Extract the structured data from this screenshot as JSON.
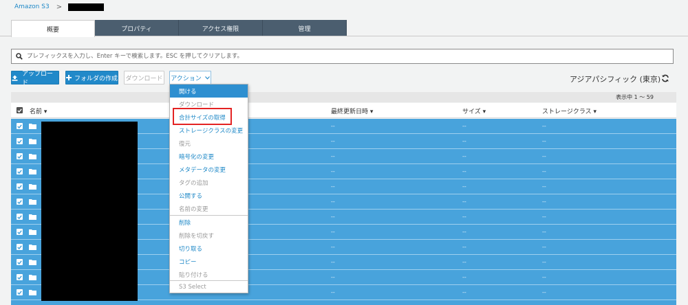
{
  "breadcrumb": {
    "root": "Amazon S3",
    "separator": ">"
  },
  "tabs": [
    {
      "label": "概要",
      "active": true
    },
    {
      "label": "プロパティ",
      "active": false
    },
    {
      "label": "アクセス権限",
      "active": false
    },
    {
      "label": "管理",
      "active": false
    }
  ],
  "search": {
    "placeholder": "プレフィックスを入力し、Enter キーで検索します。ESC を押してクリアします。"
  },
  "toolbar": {
    "upload": "アップロード",
    "create_folder": "フォルダの作成",
    "download": "ダウンロード",
    "actions": "アクション"
  },
  "region": "アジアパシフィック (東京)",
  "count_text": "表示中 1 〜 59",
  "columns": {
    "name": "名前",
    "last_modified": "最終更新日時",
    "size": "サイズ",
    "storage_class": "ストレージクラス"
  },
  "rows": [
    {
      "last_modified": "--",
      "size": "--",
      "storage_class": "--"
    },
    {
      "last_modified": "--",
      "size": "--",
      "storage_class": "--"
    },
    {
      "last_modified": "--",
      "size": "--",
      "storage_class": "--"
    },
    {
      "last_modified": "--",
      "size": "--",
      "storage_class": "--"
    },
    {
      "last_modified": "--",
      "size": "--",
      "storage_class": "--"
    },
    {
      "last_modified": "--",
      "size": "--",
      "storage_class": "--"
    },
    {
      "last_modified": "--",
      "size": "--",
      "storage_class": "--"
    },
    {
      "last_modified": "--",
      "size": "--",
      "storage_class": "--"
    },
    {
      "last_modified": "--",
      "size": "--",
      "storage_class": "--"
    },
    {
      "last_modified": "--",
      "size": "--",
      "storage_class": "--"
    },
    {
      "last_modified": "--",
      "size": "--",
      "storage_class": "--"
    },
    {
      "last_modified": "--",
      "size": "--",
      "storage_class": "--"
    }
  ],
  "actions_menu": {
    "items": [
      "開ける",
      "ダウンロード",
      "合計サイズの取得",
      "ストレージクラスの変更",
      "復元",
      "暗号化の変更",
      "メタデータの変更",
      "タグの追加",
      "公開する",
      "名前の変更",
      "削除",
      "削除を切戻す",
      "切り取る",
      "コピー",
      "貼り付ける",
      "S3 Select"
    ]
  },
  "colors": {
    "selected_row": "#48a3dc",
    "primary": "#2189c9",
    "tab_dark": "#4b5e6f",
    "highlight_box": "#e32222"
  }
}
